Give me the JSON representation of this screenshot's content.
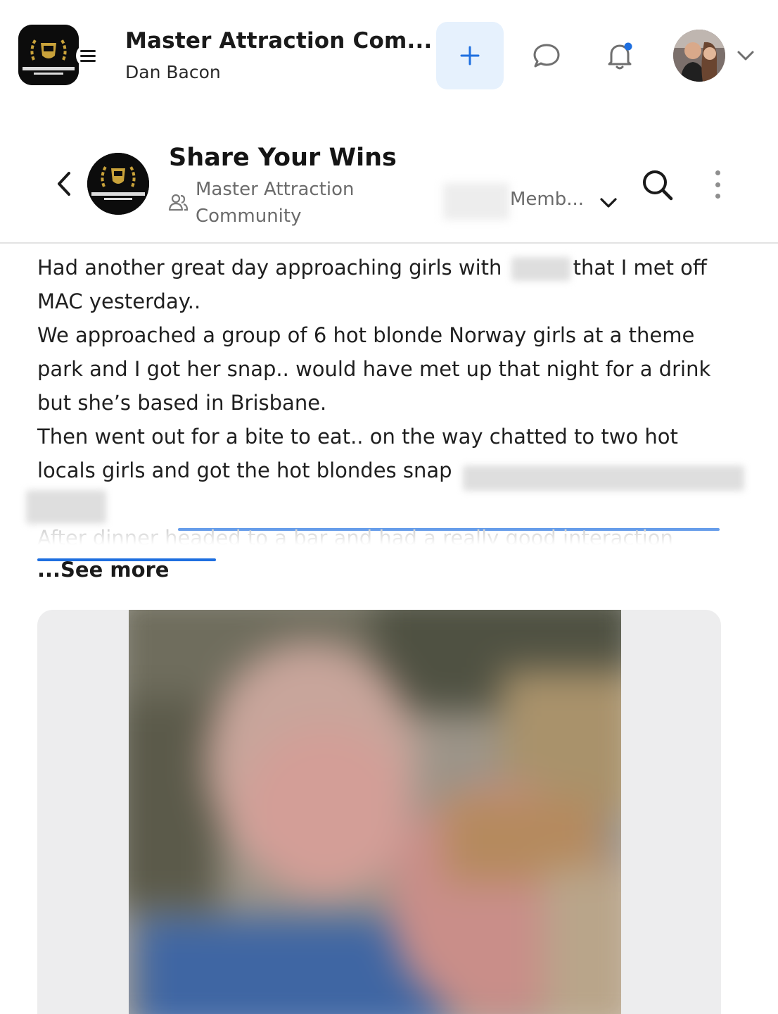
{
  "header": {
    "app_title": "Master Attraction Com...",
    "app_subtitle": "Dan Bacon",
    "logo_text": "MASTER ATTRACTION COMMUNITY",
    "icons": {
      "menu": "hamburger-menu-icon",
      "add": "plus-icon",
      "chat": "chat-bubble-icon",
      "notifications": "bell-icon",
      "account_menu": "chevron-down-icon"
    },
    "accent_color": "#1e6fe0",
    "add_button_bg": "#e6f1fd"
  },
  "group": {
    "title": "Share Your Wins",
    "community_name": "Master Attraction Community",
    "member_filter": "Memb...",
    "icons": {
      "back": "chevron-left-icon",
      "community": "people-icon",
      "search": "search-icon",
      "more": "more-vertical-icon"
    }
  },
  "post": {
    "line1_a": "Had another ",
    "line1_b": "great day approaching girls with",
    "line1_c": "that I met off",
    "line2": "MAC yesterday..",
    "line3": "We approached a group of 6 hot blonde Norway girls at a theme",
    "line4": "park and I got her snap.. would have met up that night for a drink",
    "line5": "but she’s based in Brisbane.",
    "line6": "Then went out for a bite to eat.. on the way chatted to two hot",
    "line7": "locals girls and got the hot blondes snap",
    "line8_faded": "After dinner headed to a bar and had a really good interaction",
    "see_more": "...See more"
  }
}
